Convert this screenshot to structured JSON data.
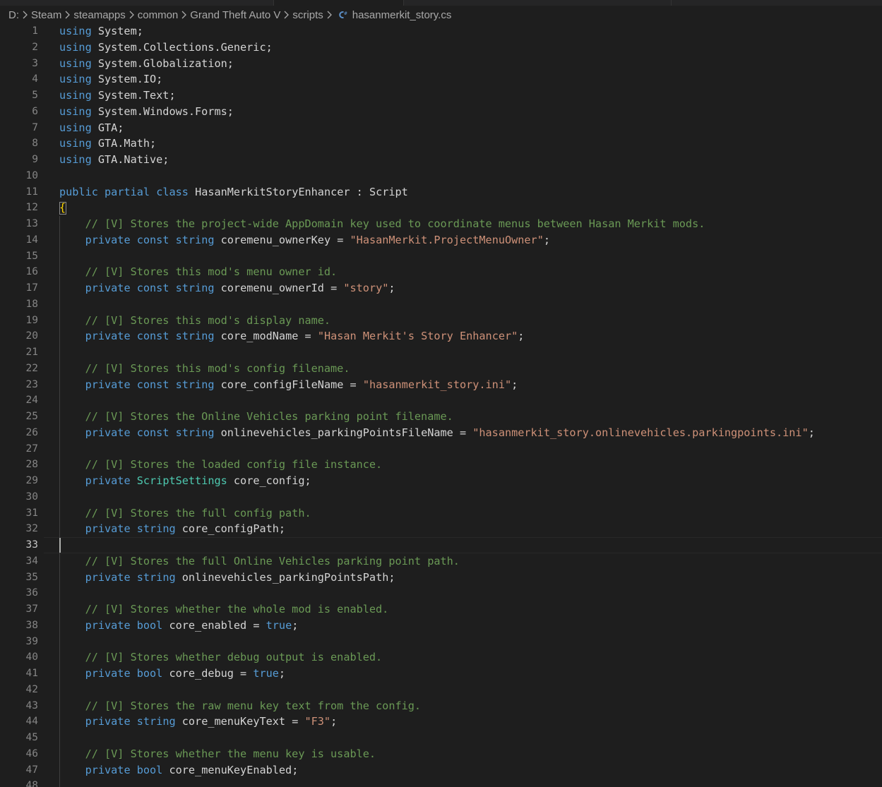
{
  "breadcrumb": {
    "items": [
      "D:",
      "Steam",
      "steamapps",
      "common",
      "Grand Theft Auto V",
      "scripts"
    ],
    "file": "hasanmerkit_story.cs",
    "file_icon": "csharp-file-icon"
  },
  "editor": {
    "active_line": 33,
    "colors": {
      "background": "#1e1e1e",
      "keyword": "#569cd6",
      "type": "#4ec9b0",
      "string": "#ce9178",
      "comment": "#6a9955",
      "plain": "#d4d4d4",
      "line_number": "#858585"
    },
    "lines": [
      {
        "n": "1",
        "tokens": [
          [
            "kw",
            "using"
          ],
          [
            "pl",
            " System;"
          ]
        ]
      },
      {
        "n": "2",
        "tokens": [
          [
            "kw",
            "using"
          ],
          [
            "pl",
            " System.Collections.Generic;"
          ]
        ]
      },
      {
        "n": "3",
        "tokens": [
          [
            "kw",
            "using"
          ],
          [
            "pl",
            " System.Globalization;"
          ]
        ]
      },
      {
        "n": "4",
        "tokens": [
          [
            "kw",
            "using"
          ],
          [
            "pl",
            " System.IO;"
          ]
        ]
      },
      {
        "n": "5",
        "tokens": [
          [
            "kw",
            "using"
          ],
          [
            "pl",
            " System.Text;"
          ]
        ]
      },
      {
        "n": "6",
        "tokens": [
          [
            "kw",
            "using"
          ],
          [
            "pl",
            " System.Windows.Forms;"
          ]
        ]
      },
      {
        "n": "7",
        "tokens": [
          [
            "kw",
            "using"
          ],
          [
            "pl",
            " GTA;"
          ]
        ]
      },
      {
        "n": "8",
        "tokens": [
          [
            "kw",
            "using"
          ],
          [
            "pl",
            " GTA.Math;"
          ]
        ]
      },
      {
        "n": "9",
        "tokens": [
          [
            "kw",
            "using"
          ],
          [
            "pl",
            " GTA.Native;"
          ]
        ]
      },
      {
        "n": "10",
        "tokens": []
      },
      {
        "n": "11",
        "tokens": [
          [
            "kw",
            "public"
          ],
          [
            "pl",
            " "
          ],
          [
            "kw",
            "partial"
          ],
          [
            "pl",
            " "
          ],
          [
            "kw",
            "class"
          ],
          [
            "pl",
            " HasanMerkitStoryEnhancer : Script"
          ]
        ]
      },
      {
        "n": "12",
        "tokens": [
          [
            "br",
            "{"
          ]
        ]
      },
      {
        "n": "13",
        "tokens": [
          [
            "pl",
            "    "
          ],
          [
            "cm",
            "// [V] Stores the project-wide AppDomain key used to coordinate menus between Hasan Merkit mods."
          ]
        ]
      },
      {
        "n": "14",
        "tokens": [
          [
            "pl",
            "    "
          ],
          [
            "kw",
            "private"
          ],
          [
            "pl",
            " "
          ],
          [
            "kw",
            "const"
          ],
          [
            "pl",
            " "
          ],
          [
            "kw",
            "string"
          ],
          [
            "pl",
            " coremenu_ownerKey = "
          ],
          [
            "str",
            "\"HasanMerkit.ProjectMenuOwner\""
          ],
          [
            "pl",
            ";"
          ]
        ]
      },
      {
        "n": "15",
        "tokens": []
      },
      {
        "n": "16",
        "tokens": [
          [
            "pl",
            "    "
          ],
          [
            "cm",
            "// [V] Stores this mod's menu owner id."
          ]
        ]
      },
      {
        "n": "17",
        "tokens": [
          [
            "pl",
            "    "
          ],
          [
            "kw",
            "private"
          ],
          [
            "pl",
            " "
          ],
          [
            "kw",
            "const"
          ],
          [
            "pl",
            " "
          ],
          [
            "kw",
            "string"
          ],
          [
            "pl",
            " coremenu_ownerId = "
          ],
          [
            "str",
            "\"story\""
          ],
          [
            "pl",
            ";"
          ]
        ]
      },
      {
        "n": "18",
        "tokens": []
      },
      {
        "n": "19",
        "tokens": [
          [
            "pl",
            "    "
          ],
          [
            "cm",
            "// [V] Stores this mod's display name."
          ]
        ]
      },
      {
        "n": "20",
        "tokens": [
          [
            "pl",
            "    "
          ],
          [
            "kw",
            "private"
          ],
          [
            "pl",
            " "
          ],
          [
            "kw",
            "const"
          ],
          [
            "pl",
            " "
          ],
          [
            "kw",
            "string"
          ],
          [
            "pl",
            " core_modName = "
          ],
          [
            "str",
            "\"Hasan Merkit's Story Enhancer\""
          ],
          [
            "pl",
            ";"
          ]
        ]
      },
      {
        "n": "21",
        "tokens": []
      },
      {
        "n": "22",
        "tokens": [
          [
            "pl",
            "    "
          ],
          [
            "cm",
            "// [V] Stores this mod's config filename."
          ]
        ]
      },
      {
        "n": "23",
        "tokens": [
          [
            "pl",
            "    "
          ],
          [
            "kw",
            "private"
          ],
          [
            "pl",
            " "
          ],
          [
            "kw",
            "const"
          ],
          [
            "pl",
            " "
          ],
          [
            "kw",
            "string"
          ],
          [
            "pl",
            " core_configFileName = "
          ],
          [
            "str",
            "\"hasanmerkit_story.ini\""
          ],
          [
            "pl",
            ";"
          ]
        ]
      },
      {
        "n": "24",
        "tokens": []
      },
      {
        "n": "25",
        "tokens": [
          [
            "pl",
            "    "
          ],
          [
            "cm",
            "// [V] Stores the Online Vehicles parking point filename."
          ]
        ]
      },
      {
        "n": "26",
        "tokens": [
          [
            "pl",
            "    "
          ],
          [
            "kw",
            "private"
          ],
          [
            "pl",
            " "
          ],
          [
            "kw",
            "const"
          ],
          [
            "pl",
            " "
          ],
          [
            "kw",
            "string"
          ],
          [
            "pl",
            " onlinevehicles_parkingPointsFileName = "
          ],
          [
            "str",
            "\"hasanmerkit_story.onlinevehicles.parkingpoints.ini\""
          ],
          [
            "pl",
            ";"
          ]
        ]
      },
      {
        "n": "27",
        "tokens": []
      },
      {
        "n": "28",
        "tokens": [
          [
            "pl",
            "    "
          ],
          [
            "cm",
            "// [V] Stores the loaded config file instance."
          ]
        ]
      },
      {
        "n": "29",
        "tokens": [
          [
            "pl",
            "    "
          ],
          [
            "kw",
            "private"
          ],
          [
            "pl",
            " "
          ],
          [
            "ty",
            "ScriptSettings"
          ],
          [
            "pl",
            " core_config;"
          ]
        ]
      },
      {
        "n": "30",
        "tokens": []
      },
      {
        "n": "31",
        "tokens": [
          [
            "pl",
            "    "
          ],
          [
            "cm",
            "// [V] Stores the full config path."
          ]
        ]
      },
      {
        "n": "32",
        "tokens": [
          [
            "pl",
            "    "
          ],
          [
            "kw",
            "private"
          ],
          [
            "pl",
            " "
          ],
          [
            "kw",
            "string"
          ],
          [
            "pl",
            " core_configPath;"
          ]
        ]
      },
      {
        "n": "33",
        "tokens": []
      },
      {
        "n": "34",
        "tokens": [
          [
            "pl",
            "    "
          ],
          [
            "cm",
            "// [V] Stores the full Online Vehicles parking point path."
          ]
        ]
      },
      {
        "n": "35",
        "tokens": [
          [
            "pl",
            "    "
          ],
          [
            "kw",
            "private"
          ],
          [
            "pl",
            " "
          ],
          [
            "kw",
            "string"
          ],
          [
            "pl",
            " onlinevehicles_parkingPointsPath;"
          ]
        ]
      },
      {
        "n": "36",
        "tokens": []
      },
      {
        "n": "37",
        "tokens": [
          [
            "pl",
            "    "
          ],
          [
            "cm",
            "// [V] Stores whether the whole mod is enabled."
          ]
        ]
      },
      {
        "n": "38",
        "tokens": [
          [
            "pl",
            "    "
          ],
          [
            "kw",
            "private"
          ],
          [
            "pl",
            " "
          ],
          [
            "kw",
            "bool"
          ],
          [
            "pl",
            " core_enabled = "
          ],
          [
            "kw",
            "true"
          ],
          [
            "pl",
            ";"
          ]
        ]
      },
      {
        "n": "39",
        "tokens": []
      },
      {
        "n": "40",
        "tokens": [
          [
            "pl",
            "    "
          ],
          [
            "cm",
            "// [V] Stores whether debug output is enabled."
          ]
        ]
      },
      {
        "n": "41",
        "tokens": [
          [
            "pl",
            "    "
          ],
          [
            "kw",
            "private"
          ],
          [
            "pl",
            " "
          ],
          [
            "kw",
            "bool"
          ],
          [
            "pl",
            " core_debug = "
          ],
          [
            "kw",
            "true"
          ],
          [
            "pl",
            ";"
          ]
        ]
      },
      {
        "n": "42",
        "tokens": []
      },
      {
        "n": "43",
        "tokens": [
          [
            "pl",
            "    "
          ],
          [
            "cm",
            "// [V] Stores the raw menu key text from the config."
          ]
        ]
      },
      {
        "n": "44",
        "tokens": [
          [
            "pl",
            "    "
          ],
          [
            "kw",
            "private"
          ],
          [
            "pl",
            " "
          ],
          [
            "kw",
            "string"
          ],
          [
            "pl",
            " core_menuKeyText = "
          ],
          [
            "str",
            "\"F3\""
          ],
          [
            "pl",
            ";"
          ]
        ]
      },
      {
        "n": "45",
        "tokens": []
      },
      {
        "n": "46",
        "tokens": [
          [
            "pl",
            "    "
          ],
          [
            "cm",
            "// [V] Stores whether the menu key is usable."
          ]
        ]
      },
      {
        "n": "47",
        "tokens": [
          [
            "pl",
            "    "
          ],
          [
            "kw",
            "private"
          ],
          [
            "pl",
            " "
          ],
          [
            "kw",
            "bool"
          ],
          [
            "pl",
            " core_menuKeyEnabled;"
          ]
        ]
      },
      {
        "n": "48",
        "tokens": []
      }
    ]
  }
}
